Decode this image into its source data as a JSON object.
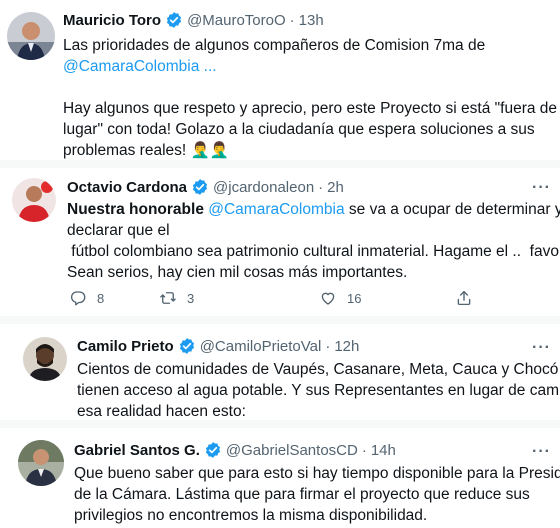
{
  "tweets": [
    {
      "name": "Mauricio Toro",
      "handle": "@MauroToroO",
      "time": "13h",
      "lines": [
        "Las prioridades de algunos compañeros de Comision 7ma de",
        "@CamaraColombia ...",
        "",
        "Hay algunos que respeto y aprecio, pero este Proyecto si está \"fuera de",
        "lugar\" con toda! Golazo a la ciudadanía que espera soluciones a sus",
        "problemas reales! 🤦‍♂️🤦‍♂️"
      ]
    },
    {
      "name": "Octavio Cardona",
      "handle": "@jcardonaleon",
      "time": "2h",
      "line1_bold": "Nuestra honorable ",
      "line1_mention": "@CamaraColombia",
      "line1_rest": " se va a ocupar de determinar y",
      "lines_rest": [
        "declarar que el",
        " fútbol colombiano sea patrimonio cultural inmaterial. Hagame el ..  favor.",
        "Sean serios, hay cien mil cosas más importantes."
      ],
      "replies": "8",
      "retweets": "3",
      "likes": "16"
    },
    {
      "name": "Camilo Prieto",
      "handle": "@CamiloPrietoVal",
      "time": "12h",
      "lines": [
        "Cientos de comunidades de Vaupés, Casanare, Meta, Cauca y Chocó no",
        "tienen acceso al agua potable. Y sus Representantes en lugar de cambiar",
        "esa realidad hacen esto:"
      ]
    },
    {
      "name": "Gabriel Santos G.",
      "handle": "@GabrielSantosCD",
      "time": "14h",
      "lines": [
        "Que bueno saber que para esto si hay tiempo disponible para la Presidenta",
        "de la Cámara. Lástima que para firmar el proyecto que reduce sus",
        "privilegios no encontremos la misma disponibilidad."
      ]
    }
  ],
  "ui": {
    "dot": "·",
    "more": "···",
    "verified_color": "#1d9bf0",
    "mention_color": "#1d9bf0"
  }
}
